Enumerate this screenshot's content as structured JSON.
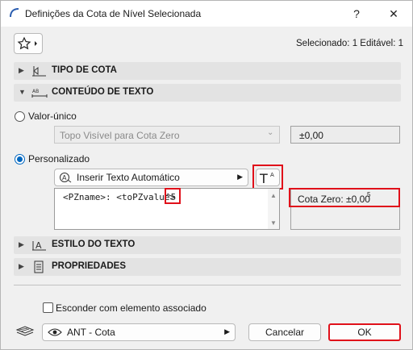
{
  "window": {
    "title": "Definições da Cota de Nível Selecionada",
    "help_label": "?",
    "close_label": "✕"
  },
  "toolbar": {
    "selection_status": "Selecionado: 1 Editável: 1"
  },
  "sections": {
    "tipo_de_cota": "TIPO DE COTA",
    "conteudo_de_texto": "CONTEÚDO DE TEXTO",
    "estilo_do_texto": "ESTILO DO TEXTO",
    "propriedades": "PROPRIEDADES"
  },
  "content": {
    "valor_unico_label": "Valor-único",
    "valor_unico_selected": false,
    "valor_unico_dropdown": "Topo Visível para  Cota Zero",
    "valor_unico_preview": "±0,00",
    "personalizado_label": "Personalizado",
    "personalizado_selected": true,
    "insert_auto_text_label": "Inserir Texto Automático",
    "text_field_value": "<PZname>: <toPZvalue>",
    "text_field_highlight": "^5",
    "preview_text": "Cota Zero: ±0,00",
    "preview_superscript": "5"
  },
  "footer": {
    "hide_with_element_label": "Esconder com elemento associado",
    "hide_with_element_checked": false,
    "layer_value": "ANT - Cota",
    "cancel_label": "Cancelar",
    "ok_label": "OK"
  },
  "colors": {
    "highlight_red": "#e0101a",
    "accent_blue": "#0067c0"
  }
}
